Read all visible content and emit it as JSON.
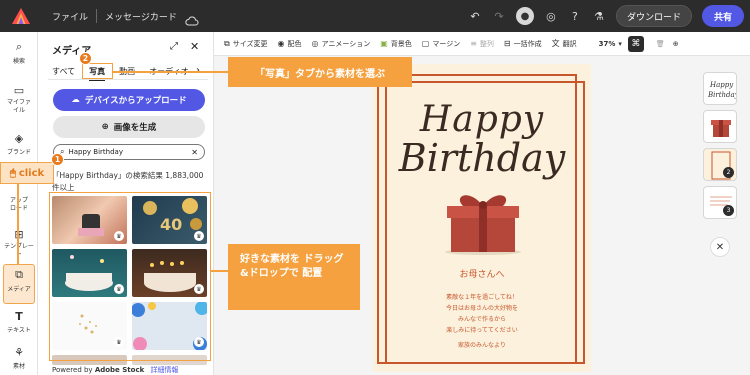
{
  "topbar": {
    "file_label": "ファイル",
    "doc_title": "メッセージカード",
    "download_label": "ダウンロード",
    "share_label": "共有"
  },
  "rail": {
    "items": [
      {
        "label": "検索",
        "icon": "search-icon"
      },
      {
        "label": "マイファイル",
        "icon": "folder-icon"
      },
      {
        "label": "ブランド",
        "icon": "brand-icon"
      },
      {
        "label": "アップロード",
        "icon": "upload-icon"
      },
      {
        "label": "テンプレート",
        "icon": "template-icon"
      },
      {
        "label": "メディア",
        "icon": "media-icon"
      },
      {
        "label": "テキスト",
        "icon": "text-icon"
      },
      {
        "label": "素材",
        "icon": "elements-icon"
      }
    ]
  },
  "panel": {
    "title": "メディア",
    "tabs": [
      "すべて",
      "写真",
      "動画",
      "オーディオ"
    ],
    "upload_label": "デバイスからアップロード",
    "generate_label": "画像を生成",
    "search_value": "Happy Birthday",
    "results_text": "「Happy Birthday」の検索結果 1,883,000 件以上",
    "powered_prefix": "Powered by",
    "powered_brand": "Adobe Stock",
    "more_info": "詳細情報"
  },
  "toolbar2": {
    "items": [
      "サイズ変更",
      "配色",
      "アニメーション",
      "背景色",
      "マージン",
      "整列",
      "一括作成",
      "翻訳"
    ],
    "zoom": "37%"
  },
  "card": {
    "title_line1": "Happy",
    "title_line2": "Birthday",
    "greeting": "お母さんへ",
    "message": [
      "素敵な１年を過ごしてね！",
      "今日はお母さんの大好物を",
      "みんなで作るから",
      "楽しみに待っててください",
      "",
      "家族のみんなより"
    ]
  },
  "pages": {
    "numbers": [
      "2",
      "3"
    ]
  },
  "annotations": {
    "step1": "1",
    "step2": "2",
    "click_label": "click",
    "callout_tab": "「写真」タブから素材を選ぶ",
    "callout_drag": "好きな素材を ドラッグ&ドロップで 配置"
  },
  "colors": {
    "accent": "#5258e4",
    "annotation": "#f5a13f",
    "card_bg": "#fbf1dc",
    "card_frame": "#c9572e"
  }
}
